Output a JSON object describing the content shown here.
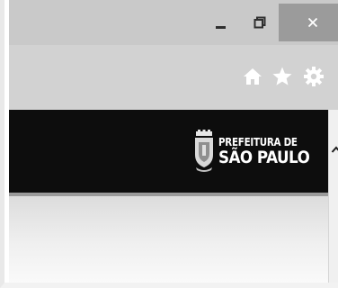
{
  "window": {
    "controls": {
      "minimize_icon": "minimize-icon",
      "restore_icon": "restore-icon",
      "close_icon": "close-icon",
      "close_button_bg": "#9b9b9b"
    }
  },
  "toolbar": {
    "icons": [
      "home-icon",
      "star-icon",
      "gear-icon"
    ]
  },
  "site": {
    "header_bg": "#0d0d0d",
    "logo_line1": "PREFEITURA DE",
    "logo_line2": "SÃO PAULO",
    "crest_icon": "city-crest-icon"
  },
  "scrollbar": {
    "up_icon": "chevron-up-icon"
  }
}
